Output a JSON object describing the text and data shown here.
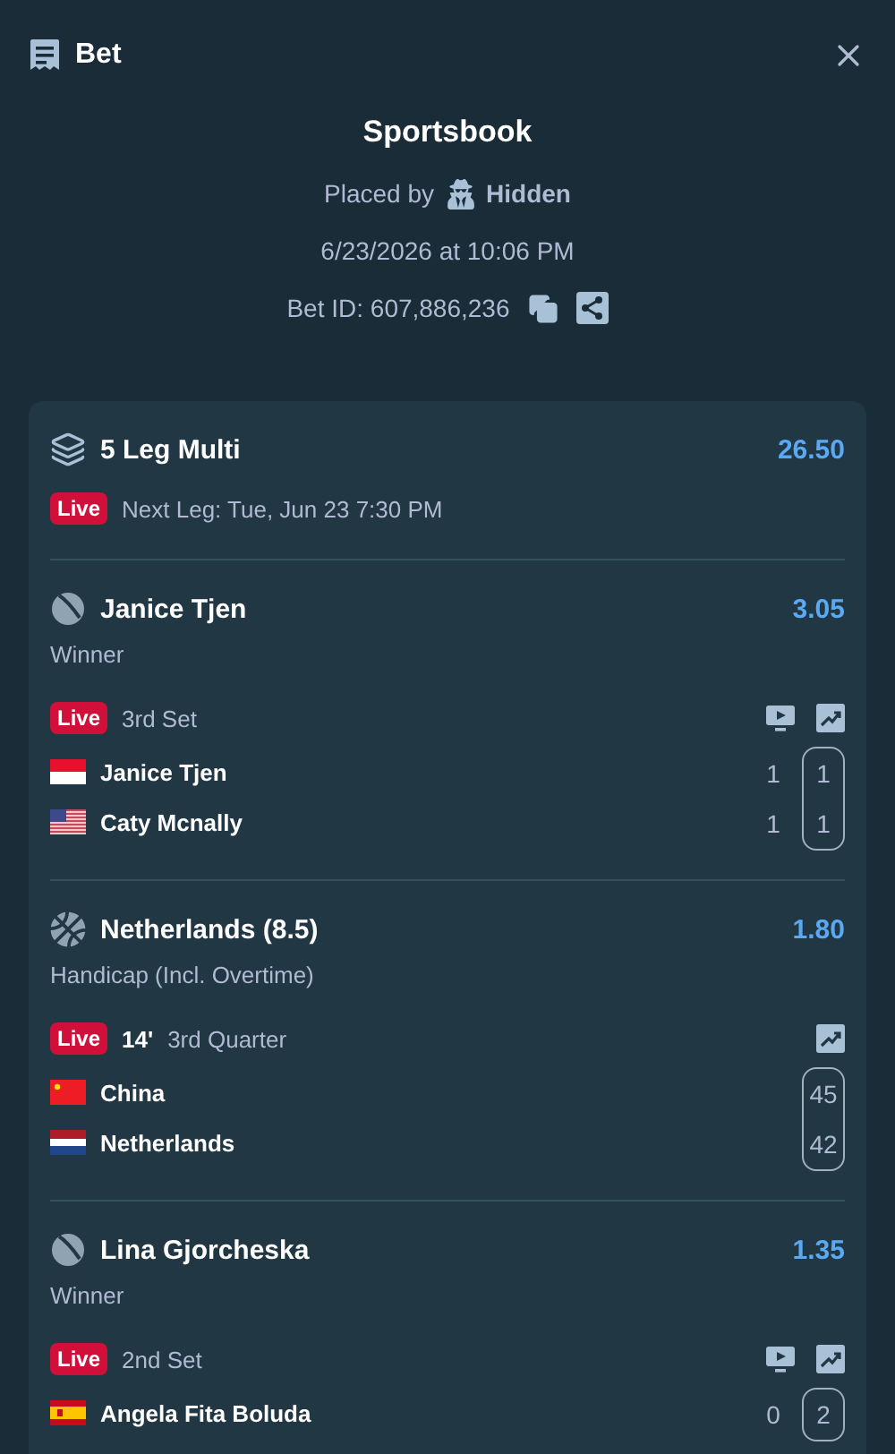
{
  "header": {
    "title": "Bet"
  },
  "summary": {
    "title": "Sportsbook",
    "placed_by_label": "Placed by",
    "placed_by_name": "Hidden",
    "date": "6/23/2026 at 10:06 PM",
    "bet_id": "Bet ID: 607,886,236"
  },
  "multi": {
    "title": "5 Leg Multi",
    "odds": "26.50",
    "live": true,
    "live_label": "Live",
    "next_leg": "Next Leg: Tue, Jun 23 7:30 PM"
  },
  "legs": [
    {
      "kind": "tennis",
      "selection": "Janice Tjen",
      "odds": "3.05",
      "market": "Winner",
      "live": true,
      "live_label": "Live",
      "period": "3rd Set",
      "stream": true,
      "stats": true,
      "competitors": [
        {
          "name": "Janice Tjen",
          "kind": "id",
          "scores": [
            "1",
            "1"
          ]
        },
        {
          "name": "Caty Mcnally",
          "kind": "us",
          "scores": [
            "1",
            "1"
          ]
        }
      ]
    },
    {
      "kind": "basketball",
      "selection": "Netherlands (8.5)",
      "odds": "1.80",
      "market": "Handicap (Incl. Overtime)",
      "live": true,
      "live_label": "Live",
      "clock": "14'",
      "period": "3rd Quarter",
      "stream": false,
      "stats": true,
      "competitors": [
        {
          "name": "China",
          "kind": "cn",
          "scores": [
            "45"
          ]
        },
        {
          "name": "Netherlands",
          "kind": "nl",
          "scores": [
            "42"
          ]
        }
      ]
    },
    {
      "kind": "tennis",
      "selection": "Lina Gjorcheska",
      "odds": "1.35",
      "market": "Winner",
      "live": true,
      "live_label": "Live",
      "period": "2nd Set",
      "stream": true,
      "stats": true,
      "competitors": [
        {
          "name": "Angela Fita Boluda",
          "kind": "es",
          "scores": [
            "0",
            "2"
          ]
        }
      ]
    }
  ]
}
